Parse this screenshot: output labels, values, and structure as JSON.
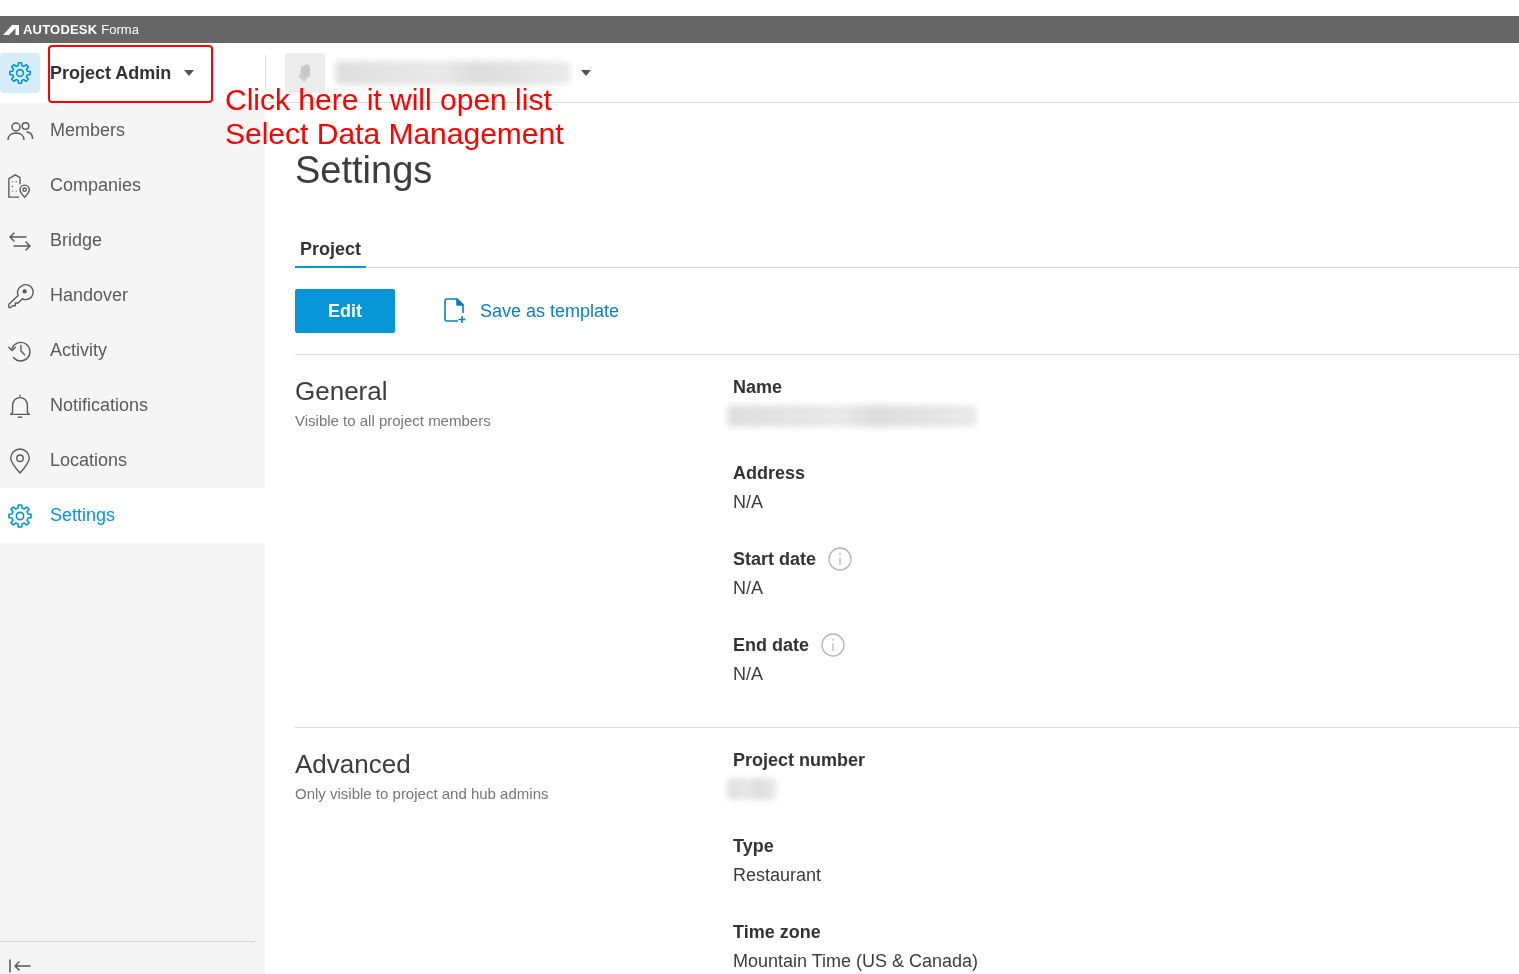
{
  "top_bar": {
    "brand": "AUTODESK",
    "product": "Forma"
  },
  "header": {
    "module_selector": {
      "label": "Project Admin"
    },
    "project_selector": {
      "name_blurred": true
    }
  },
  "callout": {
    "highlight_frame": true,
    "lines": [
      "Click here it will open list",
      "Select Data Management"
    ]
  },
  "sidebar": {
    "items": [
      {
        "label": "Members",
        "selected": false
      },
      {
        "label": "Companies",
        "selected": false
      },
      {
        "label": "Bridge",
        "selected": false
      },
      {
        "label": "Handover",
        "selected": false
      },
      {
        "label": "Activity",
        "selected": false
      },
      {
        "label": "Notifications",
        "selected": false
      },
      {
        "label": "Locations",
        "selected": false
      },
      {
        "label": "Settings",
        "selected": true
      }
    ]
  },
  "page": {
    "title": "Settings",
    "tabs": [
      {
        "label": "Project",
        "selected": true
      }
    ],
    "actions": {
      "edit": "Edit",
      "save_template": "Save as template"
    },
    "sections": [
      {
        "title": "General",
        "subtitle": "Visible to all project members",
        "fields": [
          {
            "label": "Name",
            "info": false,
            "blurred": true
          },
          {
            "label": "Address",
            "info": false,
            "value": "N/A"
          },
          {
            "label": "Start date",
            "info": true,
            "value": "N/A"
          },
          {
            "label": "End date",
            "info": true,
            "value": "N/A"
          }
        ]
      },
      {
        "title": "Advanced",
        "subtitle": "Only visible to project and hub admins",
        "fields": [
          {
            "label": "Project number",
            "info": false,
            "blurred": true
          },
          {
            "label": "Type",
            "info": false,
            "value": "Restaurant"
          },
          {
            "label": "Time zone",
            "info": false,
            "value": "Mountain Time (US & Canada)"
          }
        ]
      }
    ]
  }
}
